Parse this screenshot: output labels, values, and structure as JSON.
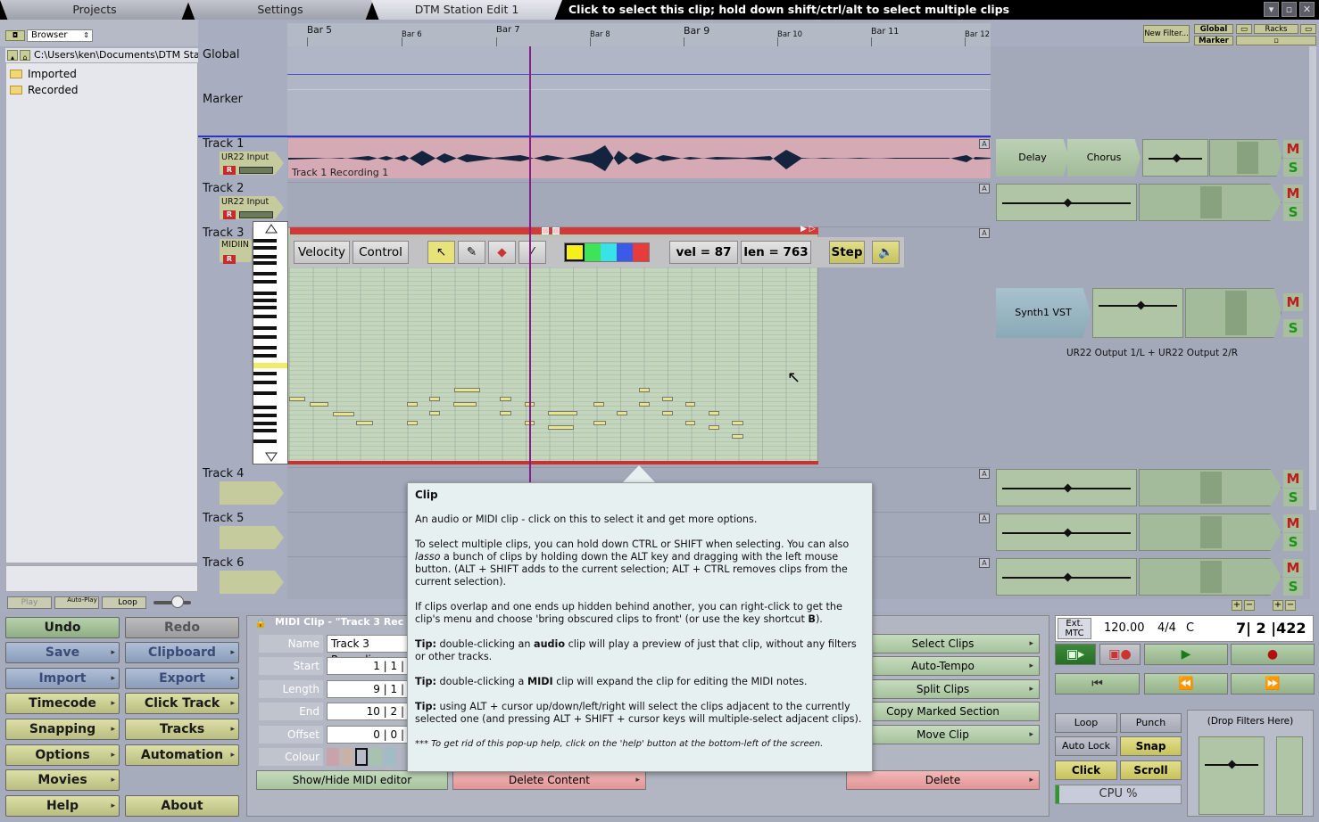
{
  "tabs": {
    "projects": "Projects",
    "settings": "Settings",
    "edit": "DTM Station Edit 1"
  },
  "hint": "Click to select this clip; hold down shift/ctrl/alt to select multiple clips",
  "browser": {
    "mode": "Browser",
    "path": "C:\\Users\\ken\\Documents\\DTM Station",
    "folders": [
      "Imported",
      "Recorded"
    ]
  },
  "mini_transport": {
    "play": "Play",
    "autoplay": "Auto-Play",
    "loop": "Loop"
  },
  "ruler": {
    "bars": [
      "Bar 5",
      "Bar 6",
      "Bar 7",
      "Bar 8",
      "Bar 9",
      "Bar 10",
      "Bar 11",
      "Bar 12"
    ]
  },
  "global": "Global",
  "marker": "Marker",
  "tracks": [
    {
      "name": "Track 1",
      "input": "UR22 Input"
    },
    {
      "name": "Track 2",
      "input": "UR22 Input"
    },
    {
      "name": "Track 3",
      "input": "MIDIIN"
    },
    {
      "name": "Track 4",
      "input": ""
    },
    {
      "name": "Track 5",
      "input": ""
    },
    {
      "name": "Track 6",
      "input": ""
    }
  ],
  "rec_label": "R",
  "clip1_name": "Track 1 Recording 1",
  "midi_toolbar": {
    "velocity": "Velocity",
    "control": "Control",
    "vel": "vel = 87",
    "len": "len = 763",
    "step": "Step"
  },
  "mixer": {
    "delay": "Delay",
    "chorus": "Chorus",
    "synth": "Synth1 VST",
    "output": "UR22 Output 1/L + UR22 Output 2/R",
    "m": "M",
    "s": "S"
  },
  "topright": {
    "newfilter": "New Filter...",
    "global": "Global",
    "marker": "Marker",
    "racks": "Racks"
  },
  "auto_btn": "A",
  "left_buttons": {
    "undo": "Undo",
    "redo": "Redo",
    "save": "Save",
    "clipboard": "Clipboard",
    "import": "Import",
    "export": "Export",
    "timecode": "Timecode",
    "clicktrack": "Click Track",
    "snapping": "Snapping",
    "tracks": "Tracks",
    "options": "Options",
    "automation": "Automation",
    "movies": "Movies",
    "help": "Help",
    "about": "About"
  },
  "midi_panel": {
    "title": "MIDI Clip - \"Track 3 Rec",
    "name_label": "Name",
    "name_value": "Track 3 Recordin",
    "start_label": "Start",
    "start_value": "1 | 1 |",
    "length_label": "Length",
    "length_value": "9 | 1 |",
    "end_label": "End",
    "end_value": "10 | 2 |",
    "offset_label": "Offset",
    "offset_value": "0 | 0 |",
    "colour_label": "Colour",
    "show_hide": "Show/Hide MIDI editor",
    "delete_content": "Delete Content",
    "delete": "Delete"
  },
  "actions": [
    "Select Clips",
    "Auto-Tempo",
    "Split Clips",
    "Copy Marked Section",
    "Move Clip"
  ],
  "transport": {
    "ext": "Ext.",
    "mtc": "MTC",
    "tempo": "120.00",
    "sig": "4/4",
    "key": "C",
    "position": "7| 2 |422"
  },
  "transport_opts": {
    "loop": "Loop",
    "punch": "Punch",
    "autolock": "Auto Lock",
    "snap": "Snap",
    "click": "Click",
    "scroll": "Scroll",
    "cpu": "CPU %",
    "drop": "(Drop Filters Here)"
  },
  "tooltip": {
    "title": "Clip",
    "p1": "An audio or MIDI clip - click on this to select it and get more options.",
    "p2a": "To select multiple clips, you can hold down CTRL or SHIFT when selecting. You can also ",
    "p2b": "lasso",
    "p2c": " a bunch of clips by holding down the ALT key and dragging with the left mouse button. (ALT + SHIFT adds to the current selection; ALT + CTRL removes clips from the current selection).",
    "p3a": "If clips overlap and one ends up hidden behind another, you can right-click to get the clip's menu and choose 'bring obscured clips to front' (or use the key shortcut ",
    "p3b": "B",
    "p3c": ").",
    "tip": "Tip:",
    "p4a": " double-clicking an ",
    "p4b": "audio",
    "p4c": " clip will play a preview of just that clip, without any filters or other tracks.",
    "p5a": " double-clicking a ",
    "p5b": "MIDI",
    "p5c": " clip will expand the clip for editing the MIDI notes.",
    "p6": " using ALT + cursor up/down/left/right will select the clips adjacent to the currently selected one (and pressing ALT + SHIFT + cursor keys will multiple-select adjacent clips).",
    "foot": "*** To get rid of this pop-up help, click on the 'help' button at the bottom-left of the screen."
  },
  "colors": {
    "accent_blue": "#2b33c8",
    "clip_pink": "#d6aab5",
    "midi_red": "#d23a3a",
    "playhead": "#8a1c8a"
  }
}
